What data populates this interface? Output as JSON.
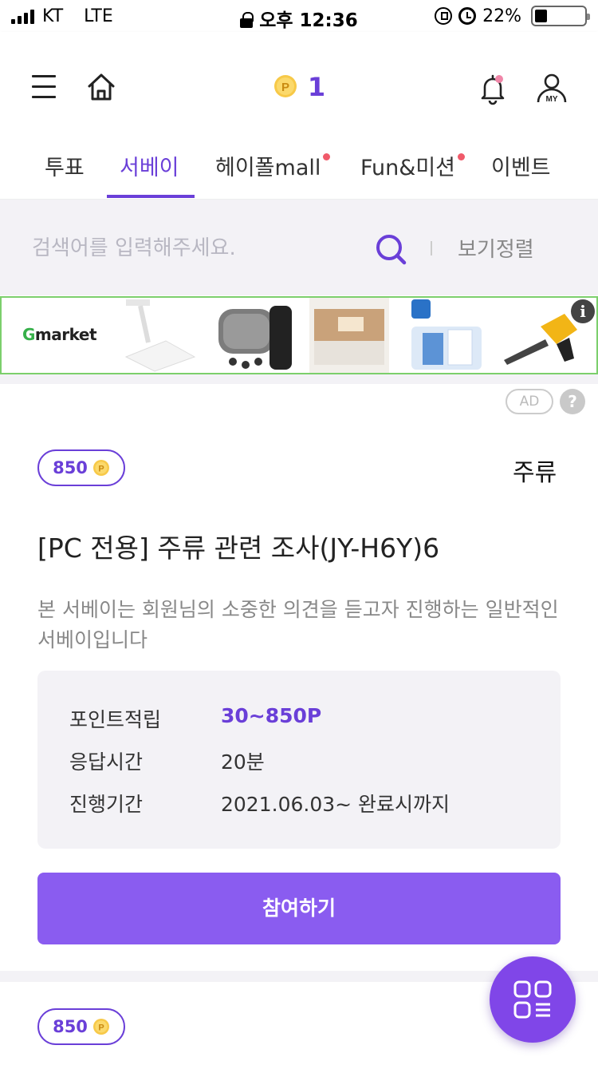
{
  "status_bar": {
    "carrier": "KT",
    "network": "LTE",
    "time": "오후 12:36",
    "battery": "22%",
    "battery_level": 0.22
  },
  "header": {
    "points": "1",
    "icons": [
      "menu-icon",
      "home-icon",
      "point-coin-icon",
      "bell-icon",
      "my-icon"
    ],
    "bell_badge_color": "#f086a8",
    "my_label": "MY"
  },
  "tabs": [
    {
      "label": "투표",
      "active": false,
      "dot": false
    },
    {
      "label": "서베이",
      "active": true,
      "dot": false
    },
    {
      "label": "헤이폴mall",
      "active": false,
      "dot": true
    },
    {
      "label": "Fun&미션",
      "active": false,
      "dot": true
    },
    {
      "label": "이벤트",
      "active": false,
      "dot": false
    }
  ],
  "search": {
    "placeholder": "검색어를 입력해주세요.",
    "sort_label": "보기정렬"
  },
  "banner": {
    "brand": "Gmarket",
    "brand_initial": "G",
    "brand_rest": "market",
    "info_label": "i"
  },
  "ad": {
    "label": "AD",
    "help": "?"
  },
  "survey": {
    "points": "850",
    "category": "주류",
    "title": "[PC 전용] 주류 관련 조사(JY-H6Y)6",
    "description": "본 서베이는 회원님의 소중한 의견을 듣고자 진행하는 일반적인 서베이입니다",
    "info": [
      {
        "key": "포인트적립",
        "value": "30~850P"
      },
      {
        "key": "응답시간",
        "value": "20분"
      },
      {
        "key": "진행기간",
        "value": "2021.06.03~ 완료시까지"
      }
    ],
    "join_label": "참여하기"
  },
  "next_survey": {
    "points": "850"
  },
  "colors": {
    "accent": "#6a3fd8",
    "button": "#8a5cf0",
    "tab_dot": "#f05a6a",
    "background": "#f3f2f6",
    "banner_border": "#7ccf6c"
  }
}
